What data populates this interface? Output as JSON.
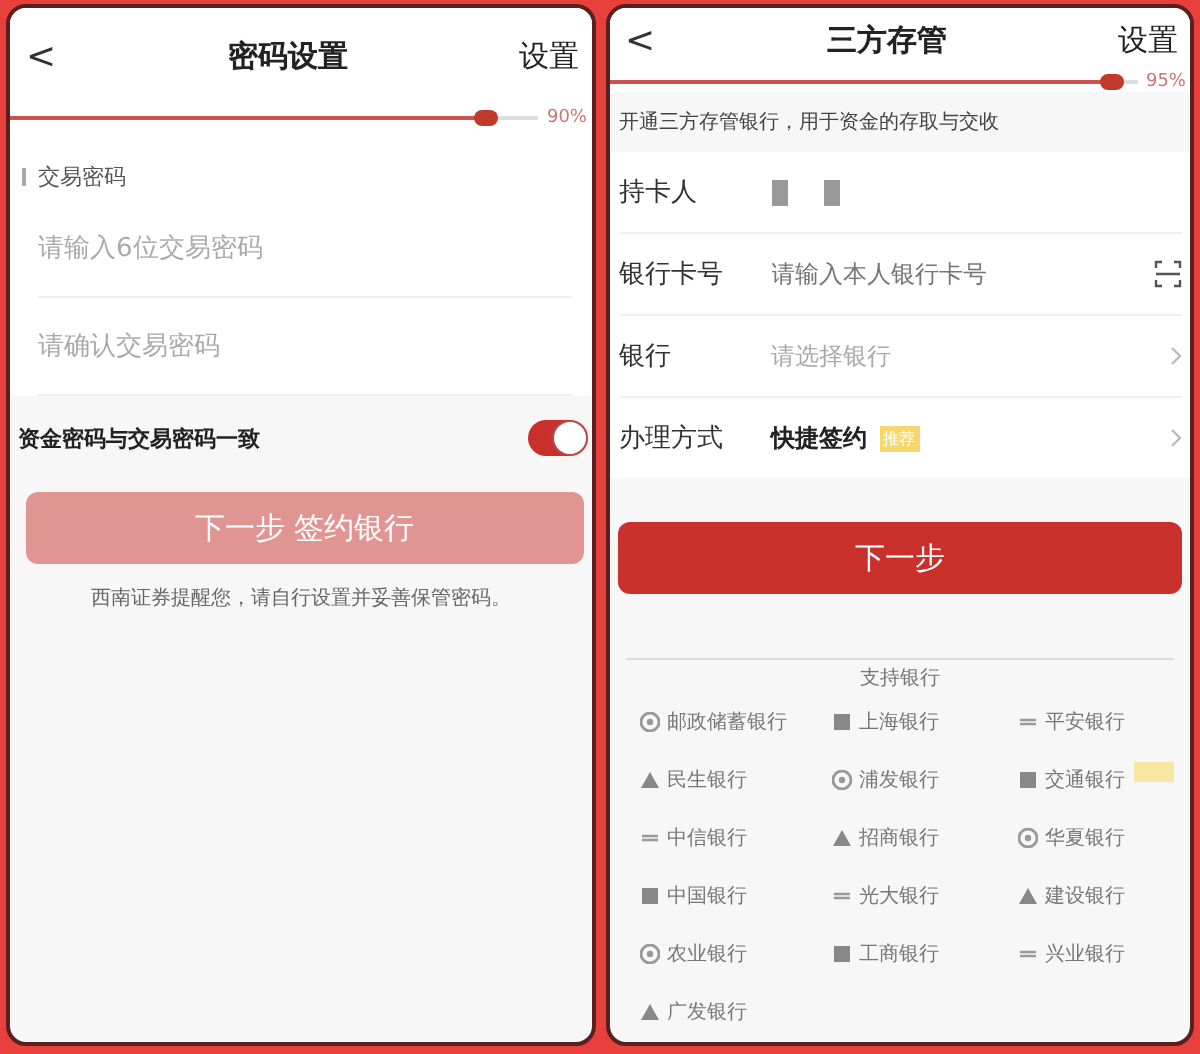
{
  "password_screen": {
    "back": "<",
    "title": "密码设置",
    "action": "设置",
    "progress": {
      "level": 0.9,
      "reading": "90%"
    },
    "section_label": "交易密码",
    "fields": [
      {
        "placeholder": "请输入6位交易密码"
      },
      {
        "placeholder": "请确认交易密码"
      }
    ],
    "toggle": {
      "label": "资金密码与交易密码一致",
      "on": true
    },
    "button": {
      "label": "下一步 签约银行",
      "disabled": true
    },
    "hint": "西南证券提醒您，请自行设置并妥善保管密码。"
  },
  "bank_screen": {
    "back": "<",
    "title": "三方存管",
    "action": "设置",
    "progress": {
      "level": 0.95,
      "reading": "95%"
    },
    "info": "开通三方存管银行，用于资金的存取与交收",
    "rows": [
      {
        "kind": "masked",
        "label": "持卡人"
      },
      {
        "kind": "input",
        "label": "银行卡号",
        "placeholder": "请输入本人银行卡号"
      },
      {
        "kind": "select",
        "label": "银行",
        "placeholder": "请选择银行"
      },
      {
        "kind": "choice",
        "label": "办理方式",
        "value": "快捷签约",
        "badge": "推荐"
      }
    ],
    "button": {
      "label": "下一步",
      "disabled": false
    },
    "banks_title": "支持银行",
    "banks": [
      {
        "name": "邮政储蓄银行",
        "tagged": false
      },
      {
        "name": "上海银行",
        "tagged": false
      },
      {
        "name": "平安银行",
        "tagged": false
      },
      {
        "name": "民生银行",
        "tagged": false
      },
      {
        "name": "浦发银行",
        "tagged": false
      },
      {
        "name": "交通银行",
        "tagged": true
      },
      {
        "name": "中信银行",
        "tagged": false
      },
      {
        "name": "招商银行",
        "tagged": false
      },
      {
        "name": "华夏银行",
        "tagged": false
      },
      {
        "name": "中国银行",
        "tagged": false
      },
      {
        "name": "光大银行",
        "tagged": false
      },
      {
        "name": "建设银行",
        "tagged": false
      },
      {
        "name": "农业银行",
        "tagged": false
      },
      {
        "name": "工商银行",
        "tagged": false
      },
      {
        "name": "兴业银行",
        "tagged": false
      },
      {
        "name": "广发银行",
        "tagged": false
      }
    ]
  }
}
